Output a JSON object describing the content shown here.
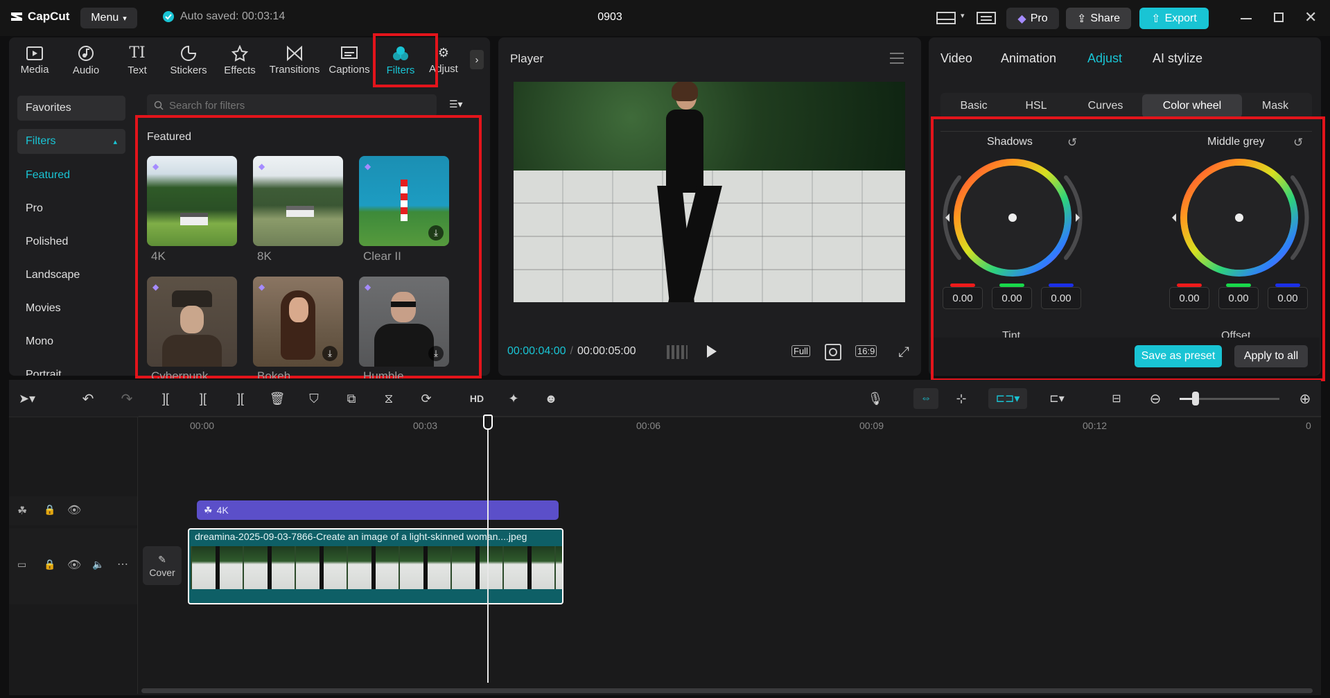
{
  "app": {
    "name": "CapCut",
    "menu_label": "Menu",
    "autosave": "Auto saved: 00:03:14",
    "project_title": "0903"
  },
  "titlebar": {
    "pro_label": "Pro",
    "share_label": "Share",
    "export_label": "Export"
  },
  "media_tools": [
    {
      "label": "Media",
      "icon": "media-icon"
    },
    {
      "label": "Audio",
      "icon": "audio-icon"
    },
    {
      "label": "Text",
      "icon": "text-icon"
    },
    {
      "label": "Stickers",
      "icon": "stickers-icon"
    },
    {
      "label": "Effects",
      "icon": "effects-icon"
    },
    {
      "label": "Transitions",
      "icon": "transitions-icon"
    },
    {
      "label": "Captions",
      "icon": "captions-icon"
    },
    {
      "label": "Filters",
      "icon": "filters-icon",
      "active": true
    },
    {
      "label": "Adjust",
      "icon": "adjust-icon"
    }
  ],
  "sidebar": {
    "favorites": "Favorites",
    "filters": "Filters",
    "items": [
      "Featured",
      "Pro",
      "Polished",
      "Landscape",
      "Movies",
      "Mono",
      "Portrait"
    ]
  },
  "search": {
    "placeholder": "Search for filters"
  },
  "featured": {
    "heading": "Featured",
    "filters": [
      "4K",
      "8K",
      "Clear II",
      "Cyberpunk",
      "Bokeh",
      "Humble"
    ]
  },
  "player": {
    "title": "Player",
    "current_time": "00:00:04:00",
    "total_time": "00:00:05:00",
    "full_label": "Full",
    "ratio_label": "16:9"
  },
  "props": {
    "tabs": [
      "Video",
      "Animation",
      "Adjust",
      "AI stylize"
    ],
    "active_tab": "Adjust",
    "subtabs": [
      "Basic",
      "HSL",
      "Curves",
      "Color wheel",
      "Mask"
    ],
    "active_subtab": "Color wheel",
    "wheels": [
      {
        "title": "Shadows",
        "values": [
          "0.00",
          "0.00",
          "0.00"
        ]
      },
      {
        "title": "Middle grey",
        "values": [
          "0.00",
          "0.00",
          "0.00"
        ]
      }
    ],
    "next_row": [
      "Tint",
      "Offset"
    ],
    "save_preset": "Save as preset",
    "apply_all": "Apply to all"
  },
  "timeline": {
    "ruler": [
      "00:00",
      "00:03",
      "00:06",
      "00:09",
      "00:12",
      "0"
    ],
    "filter_clip_label": "4K",
    "video_clip_label": "dreamina-2025-09-03-7866-Create an image of a light-skinned woman....jpeg",
    "cover_label": "Cover"
  },
  "colors": {
    "accent": "#19c4d4",
    "highlight": "#e3141b",
    "filter_clip": "#5b4fc9",
    "video_clip": "#0e5f66"
  }
}
